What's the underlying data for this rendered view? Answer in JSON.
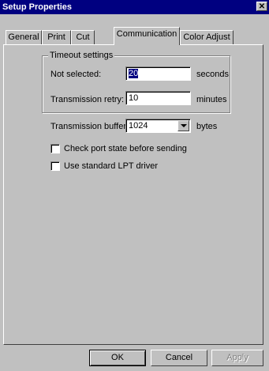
{
  "window": {
    "title": "Setup Properties",
    "close_glyph": "✕"
  },
  "tabs": [
    {
      "label": "General",
      "active": false
    },
    {
      "label": "Print",
      "active": false
    },
    {
      "label": "Cut",
      "active": false
    },
    {
      "label": "Communication",
      "active": true
    },
    {
      "label": "Color Adjust",
      "active": false
    }
  ],
  "timeout": {
    "group_title": "Timeout settings",
    "not_selected_label": "Not selected:",
    "not_selected_value": "20",
    "not_selected_unit": "seconds",
    "retry_label": "Transmission retry:",
    "retry_value": "10",
    "retry_unit": "minutes"
  },
  "buffer": {
    "label": "Transmission buffer:",
    "value": "1024",
    "unit": "bytes"
  },
  "options": [
    {
      "label": "Check port state before sending",
      "checked": false
    },
    {
      "label": "Use standard LPT driver",
      "checked": false
    }
  ],
  "buttons": {
    "ok": "OK",
    "cancel": "Cancel",
    "apply": "Apply"
  }
}
